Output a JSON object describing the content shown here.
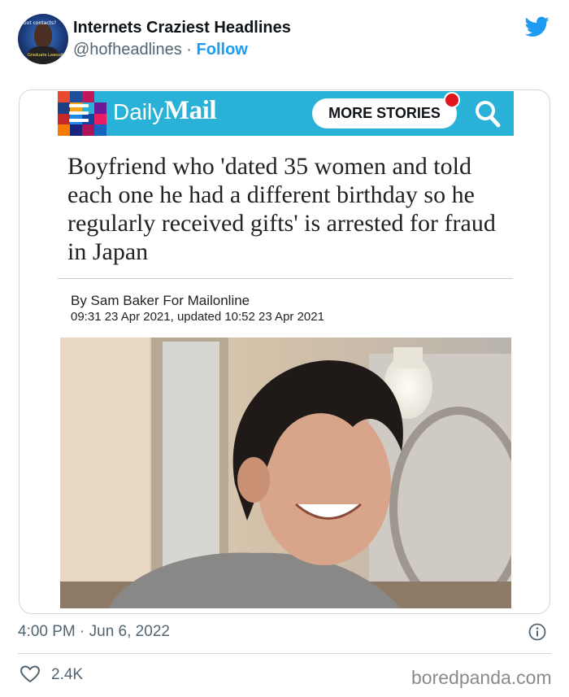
{
  "tweet": {
    "account_name": "Internets Craziest Headlines",
    "handle": "@hofheadlines",
    "separator": "·",
    "follow_label": "Follow",
    "avatar_text_top": "Got contacts?",
    "avatar_text_bottom": "Graduate Lawsuits",
    "timestamp": "4:00 PM · Jun 6, 2022",
    "like_count": "2.4K"
  },
  "article": {
    "site_daily": "Daily",
    "site_mail": "Mail",
    "more_stories_label": "MORE STORIES",
    "headline": "Boyfriend who 'dated 35 women and told each one he had a different birthday so he regularly received gifts' is arrested for fraud in Japan",
    "byline": "By Sam Baker For Mailonline",
    "dateline": "09:31 23 Apr 2021, updated 10:52 23 Apr 2021"
  },
  "watermark": "boredpanda.com",
  "icons": {
    "platform": "twitter-bird-icon",
    "menu": "hamburger-menu-icon",
    "search": "search-icon",
    "info": "info-icon",
    "like": "heart-icon"
  },
  "colors": {
    "twitter_blue": "#1d9bf0",
    "dailymail_bar": "#2ab1d8",
    "notification_red": "#e1161c",
    "secondary_text": "#536471"
  }
}
